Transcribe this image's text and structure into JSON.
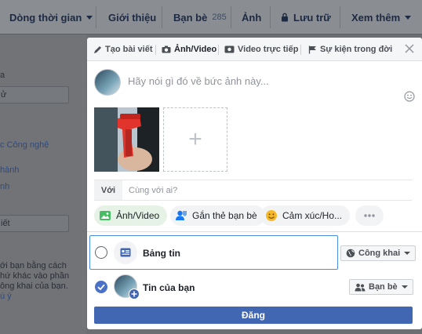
{
  "nav": {
    "timeline": "Dòng thời gian",
    "about": "Giới thiệu",
    "friends": "Bạn bè",
    "friends_count": "285",
    "photos": "Ảnh",
    "archive": "Lưu trữ",
    "more": "Xem thêm"
  },
  "left": {
    "l1": "a",
    "l2": "ử",
    "l3": "c Công nghệ",
    "l4": "hành",
    "l5": "nh",
    "l6": "iết",
    "l7": "ới bạn bằng cách",
    "l8": "hứ khác vào phần",
    "l9": "ông khai của bạn.",
    "l10": "ú ý"
  },
  "composer": {
    "tabs": {
      "create_post": "Tạo bài viết",
      "photo_video": "Ảnh/Video",
      "live_video": "Video trực tiếp",
      "life_event": "Sự kiện trong đời"
    },
    "status_placeholder": "Hãy nói gì đó về bức ảnh này...",
    "with_label": "Với",
    "with_placeholder": "Cùng với ai?",
    "actions": {
      "photo_video": "Ảnh/Video",
      "tag_friends": "Gắn thẻ bạn bè",
      "feeling": "Cảm xúc/Ho..."
    },
    "destinations": {
      "news_feed": {
        "label": "Bảng tin",
        "privacy": "Công khai",
        "checked": false
      },
      "stories": {
        "label": "Tin của bạn",
        "privacy": "Bạn bè",
        "checked": true
      }
    },
    "post_button": "Đăng"
  },
  "colors": {
    "accent": "#4267b2",
    "focus_border": "#4a90e2",
    "check": "#4a70c7"
  }
}
